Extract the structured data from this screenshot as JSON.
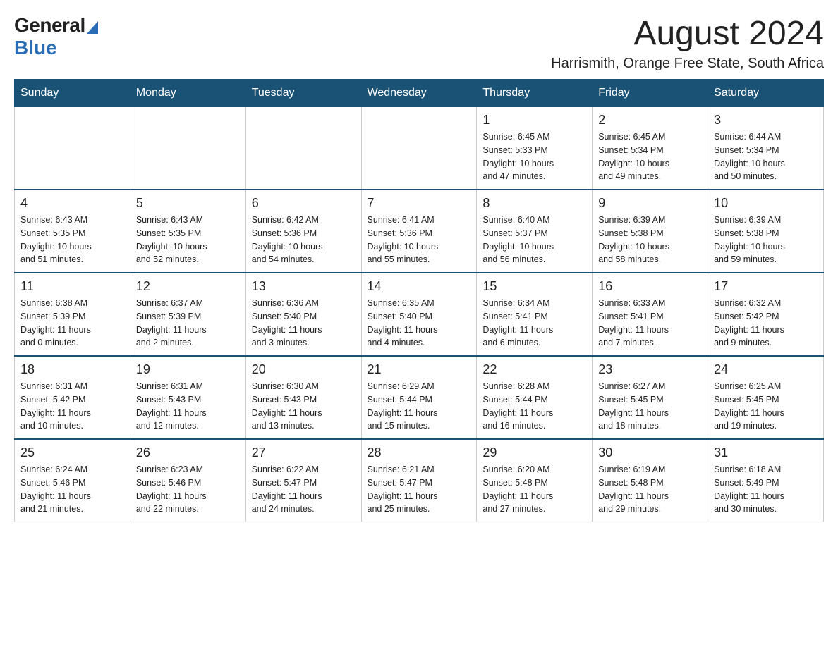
{
  "logo": {
    "general": "General",
    "blue": "Blue"
  },
  "header": {
    "title": "August 2024",
    "subtitle": "Harrismith, Orange Free State, South Africa"
  },
  "days": {
    "headers": [
      "Sunday",
      "Monday",
      "Tuesday",
      "Wednesday",
      "Thursday",
      "Friday",
      "Saturday"
    ]
  },
  "weeks": [
    [
      {
        "day": "",
        "info": ""
      },
      {
        "day": "",
        "info": ""
      },
      {
        "day": "",
        "info": ""
      },
      {
        "day": "",
        "info": ""
      },
      {
        "day": "1",
        "info": "Sunrise: 6:45 AM\nSunset: 5:33 PM\nDaylight: 10 hours\nand 47 minutes."
      },
      {
        "day": "2",
        "info": "Sunrise: 6:45 AM\nSunset: 5:34 PM\nDaylight: 10 hours\nand 49 minutes."
      },
      {
        "day": "3",
        "info": "Sunrise: 6:44 AM\nSunset: 5:34 PM\nDaylight: 10 hours\nand 50 minutes."
      }
    ],
    [
      {
        "day": "4",
        "info": "Sunrise: 6:43 AM\nSunset: 5:35 PM\nDaylight: 10 hours\nand 51 minutes."
      },
      {
        "day": "5",
        "info": "Sunrise: 6:43 AM\nSunset: 5:35 PM\nDaylight: 10 hours\nand 52 minutes."
      },
      {
        "day": "6",
        "info": "Sunrise: 6:42 AM\nSunset: 5:36 PM\nDaylight: 10 hours\nand 54 minutes."
      },
      {
        "day": "7",
        "info": "Sunrise: 6:41 AM\nSunset: 5:36 PM\nDaylight: 10 hours\nand 55 minutes."
      },
      {
        "day": "8",
        "info": "Sunrise: 6:40 AM\nSunset: 5:37 PM\nDaylight: 10 hours\nand 56 minutes."
      },
      {
        "day": "9",
        "info": "Sunrise: 6:39 AM\nSunset: 5:38 PM\nDaylight: 10 hours\nand 58 minutes."
      },
      {
        "day": "10",
        "info": "Sunrise: 6:39 AM\nSunset: 5:38 PM\nDaylight: 10 hours\nand 59 minutes."
      }
    ],
    [
      {
        "day": "11",
        "info": "Sunrise: 6:38 AM\nSunset: 5:39 PM\nDaylight: 11 hours\nand 0 minutes."
      },
      {
        "day": "12",
        "info": "Sunrise: 6:37 AM\nSunset: 5:39 PM\nDaylight: 11 hours\nand 2 minutes."
      },
      {
        "day": "13",
        "info": "Sunrise: 6:36 AM\nSunset: 5:40 PM\nDaylight: 11 hours\nand 3 minutes."
      },
      {
        "day": "14",
        "info": "Sunrise: 6:35 AM\nSunset: 5:40 PM\nDaylight: 11 hours\nand 4 minutes."
      },
      {
        "day": "15",
        "info": "Sunrise: 6:34 AM\nSunset: 5:41 PM\nDaylight: 11 hours\nand 6 minutes."
      },
      {
        "day": "16",
        "info": "Sunrise: 6:33 AM\nSunset: 5:41 PM\nDaylight: 11 hours\nand 7 minutes."
      },
      {
        "day": "17",
        "info": "Sunrise: 6:32 AM\nSunset: 5:42 PM\nDaylight: 11 hours\nand 9 minutes."
      }
    ],
    [
      {
        "day": "18",
        "info": "Sunrise: 6:31 AM\nSunset: 5:42 PM\nDaylight: 11 hours\nand 10 minutes."
      },
      {
        "day": "19",
        "info": "Sunrise: 6:31 AM\nSunset: 5:43 PM\nDaylight: 11 hours\nand 12 minutes."
      },
      {
        "day": "20",
        "info": "Sunrise: 6:30 AM\nSunset: 5:43 PM\nDaylight: 11 hours\nand 13 minutes."
      },
      {
        "day": "21",
        "info": "Sunrise: 6:29 AM\nSunset: 5:44 PM\nDaylight: 11 hours\nand 15 minutes."
      },
      {
        "day": "22",
        "info": "Sunrise: 6:28 AM\nSunset: 5:44 PM\nDaylight: 11 hours\nand 16 minutes."
      },
      {
        "day": "23",
        "info": "Sunrise: 6:27 AM\nSunset: 5:45 PM\nDaylight: 11 hours\nand 18 minutes."
      },
      {
        "day": "24",
        "info": "Sunrise: 6:25 AM\nSunset: 5:45 PM\nDaylight: 11 hours\nand 19 minutes."
      }
    ],
    [
      {
        "day": "25",
        "info": "Sunrise: 6:24 AM\nSunset: 5:46 PM\nDaylight: 11 hours\nand 21 minutes."
      },
      {
        "day": "26",
        "info": "Sunrise: 6:23 AM\nSunset: 5:46 PM\nDaylight: 11 hours\nand 22 minutes."
      },
      {
        "day": "27",
        "info": "Sunrise: 6:22 AM\nSunset: 5:47 PM\nDaylight: 11 hours\nand 24 minutes."
      },
      {
        "day": "28",
        "info": "Sunrise: 6:21 AM\nSunset: 5:47 PM\nDaylight: 11 hours\nand 25 minutes."
      },
      {
        "day": "29",
        "info": "Sunrise: 6:20 AM\nSunset: 5:48 PM\nDaylight: 11 hours\nand 27 minutes."
      },
      {
        "day": "30",
        "info": "Sunrise: 6:19 AM\nSunset: 5:48 PM\nDaylight: 11 hours\nand 29 minutes."
      },
      {
        "day": "31",
        "info": "Sunrise: 6:18 AM\nSunset: 5:49 PM\nDaylight: 11 hours\nand 30 minutes."
      }
    ]
  ]
}
